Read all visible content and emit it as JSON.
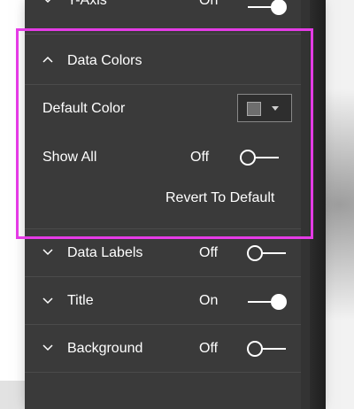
{
  "top_partial": {
    "label": "Y-Axis",
    "state": "On"
  },
  "data_colors": {
    "title": "Data Colors",
    "default_color_label": "Default Color",
    "default_color_swatch": "#6e6e6e",
    "show_all_label": "Show All",
    "show_all_state": "Off",
    "revert_label": "Revert To Default"
  },
  "sections": [
    {
      "label": "Data Labels",
      "state": "Off"
    },
    {
      "label": "Title",
      "state": "On"
    },
    {
      "label": "Background",
      "state": "Off"
    }
  ],
  "colors": {
    "highlight": "#e53be6",
    "panel": "#3a3a3a"
  }
}
